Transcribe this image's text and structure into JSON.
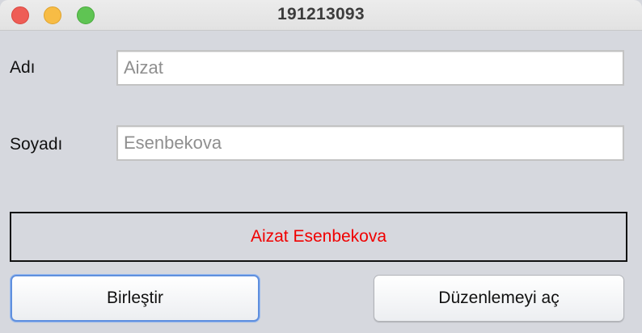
{
  "window": {
    "title": "191213093"
  },
  "form": {
    "first_name_label": "Adı",
    "first_name_value": "Aizat",
    "last_name_label": "Soyadı",
    "last_name_value": "Esenbekova"
  },
  "result": {
    "text": "Aizat Esenbekova",
    "color": "#f00000"
  },
  "buttons": {
    "combine_label": "Birleştir",
    "enable_edit_label": "Düzenlemeyi aç"
  },
  "colors": {
    "close": "#ee5d56",
    "minimize": "#f7bc45",
    "maximize": "#5fc453",
    "focus_ring": "#5f8fde"
  }
}
